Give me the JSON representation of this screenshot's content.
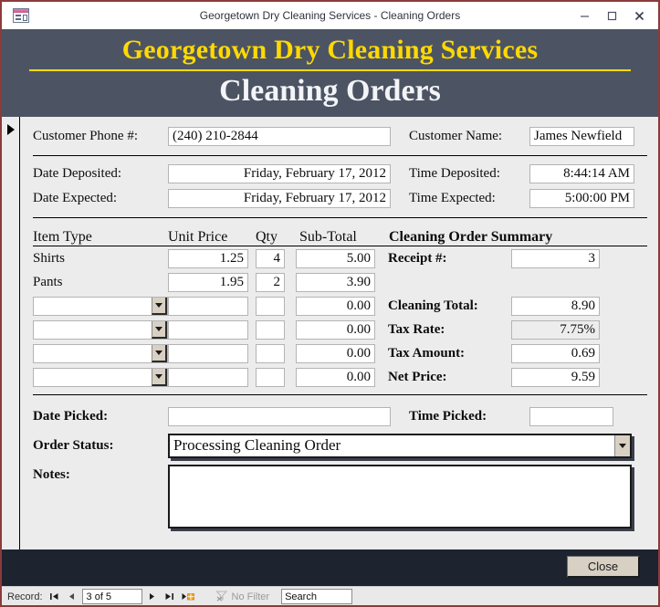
{
  "window": {
    "title": "Georgetown Dry Cleaning Services - Cleaning Orders",
    "app_icon": "access-form-icon",
    "minimize_icon": "minimize-icon",
    "maximize_icon": "maximize-icon",
    "close_icon": "close-icon"
  },
  "banner": {
    "company": "Georgetown Dry Cleaning Services",
    "form_title": "Cleaning Orders",
    "company_color": "#ffd900",
    "title_color": "#f2f4f8",
    "background_color": "#4c5463",
    "rule_color": "#ffd900"
  },
  "customer": {
    "phone_label": "Customer Phone #:",
    "phone_value": "(240) 210-2844",
    "name_label": "Customer Name:",
    "name_value": "James Newfield"
  },
  "schedule": {
    "date_deposited_label": "Date Deposited:",
    "date_deposited_value": "Friday, February 17, 2012",
    "time_deposited_label": "Time Deposited:",
    "time_deposited_value": "8:44:14 AM",
    "date_expected_label": "Date Expected:",
    "date_expected_value": "Friday, February 17, 2012",
    "time_expected_label": "Time Expected:",
    "time_expected_value": "5:00:00 PM"
  },
  "items": {
    "headers": {
      "item_type": "Item Type",
      "unit_price": "Unit Price",
      "qty": "Qty",
      "sub_total": "Sub-Total"
    },
    "rows": [
      {
        "item_type": "Shirts",
        "unit_price": "1.25",
        "qty": "4",
        "sub_total": "5.00",
        "is_combo": false
      },
      {
        "item_type": "Pants",
        "unit_price": "1.95",
        "qty": "2",
        "sub_total": "3.90",
        "is_combo": false
      },
      {
        "item_type": "",
        "unit_price": "",
        "qty": "",
        "sub_total": "0.00",
        "is_combo": true
      },
      {
        "item_type": "",
        "unit_price": "",
        "qty": "",
        "sub_total": "0.00",
        "is_combo": true
      },
      {
        "item_type": "",
        "unit_price": "",
        "qty": "",
        "sub_total": "0.00",
        "is_combo": true
      },
      {
        "item_type": "",
        "unit_price": "",
        "qty": "",
        "sub_total": "0.00",
        "is_combo": true
      }
    ]
  },
  "summary": {
    "title": "Cleaning Order Summary",
    "receipt_label": "Receipt #:",
    "receipt_value": "3",
    "cleaning_total_label": "Cleaning Total:",
    "cleaning_total_value": "8.90",
    "tax_rate_label": "Tax Rate:",
    "tax_rate_value": "7.75%",
    "tax_amount_label": "Tax Amount:",
    "tax_amount_value": "0.69",
    "net_price_label": "Net Price:",
    "net_price_value": "9.59"
  },
  "pickup": {
    "date_picked_label": "Date Picked:",
    "date_picked_value": "",
    "time_picked_label": "Time Picked:",
    "time_picked_value": "",
    "order_status_label": "Order Status:",
    "order_status_value": "Processing Cleaning Order",
    "notes_label": "Notes:",
    "notes_value": ""
  },
  "footer": {
    "close_label": "Close",
    "close_button_color": "#d8d0c3",
    "background_color": "#1e2330"
  },
  "navigator": {
    "record_label": "Record:",
    "first_icon": "first-record-icon",
    "previous_icon": "previous-record-icon",
    "record_position": "3 of 5",
    "next_icon": "next-record-icon",
    "last_icon": "last-record-icon",
    "new_icon": "new-record-icon",
    "filter_icon": "no-filter-icon",
    "filter_label": "No Filter",
    "search_value": "Search"
  }
}
